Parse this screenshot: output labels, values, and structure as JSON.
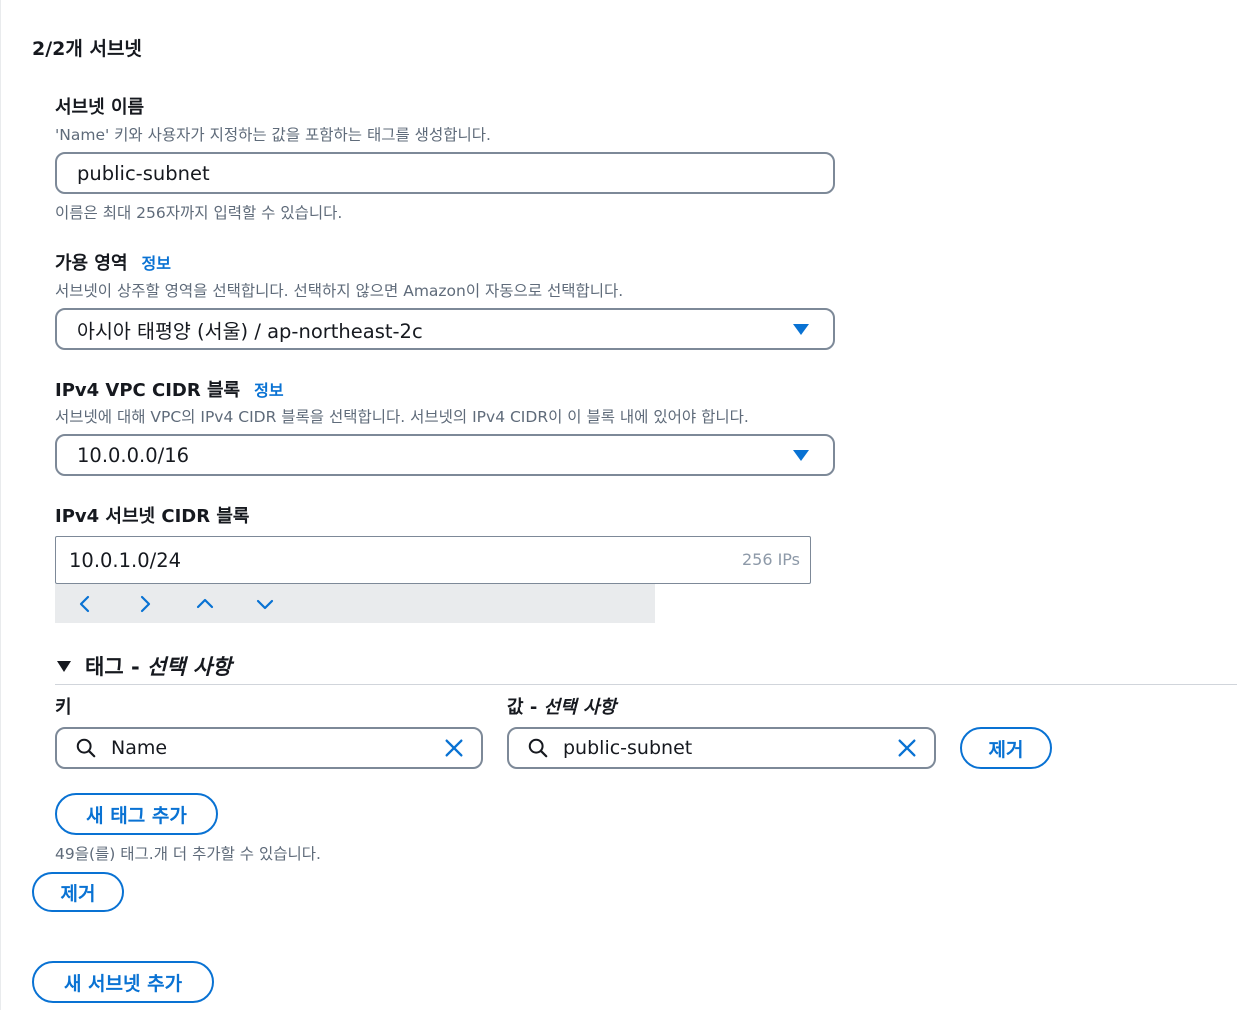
{
  "section": {
    "title": "2/2개 서브넷"
  },
  "subnet_name": {
    "label": "서브넷 이름",
    "description": "'Name' 키와 사용자가 지정하는 값을 포함하는 태그를 생성합니다.",
    "value": "public-subnet",
    "constraint": "이름은 최대 256자까지 입력할 수 있습니다."
  },
  "availability_zone": {
    "label": "가용 영역",
    "info": "정보",
    "description": "서브넷이 상주할 영역을 선택합니다. 선택하지 않으면 Amazon이 자동으로 선택합니다.",
    "value": "아시아 태평양 (서울) / ap-northeast-2c"
  },
  "vpc_cidr": {
    "label": "IPv4 VPC CIDR 블록",
    "info": "정보",
    "description": "서브넷에 대해 VPC의 IPv4 CIDR 블록을 선택합니다. 서브넷의 IPv4 CIDR이 이 블록 내에 있어야 합니다.",
    "value": "10.0.0.0/16"
  },
  "subnet_cidr": {
    "label": "IPv4 서브넷 CIDR 블록",
    "value": "10.0.1.0/24",
    "suffix": "256 IPs"
  },
  "tags": {
    "header_main": "태그 - ",
    "header_optional": "선택 사항",
    "key_label": "키",
    "value_label_main": "값 - ",
    "value_label_optional": "선택 사항",
    "rows": [
      {
        "key": "Name",
        "value": "public-subnet",
        "remove_label": "제거"
      }
    ],
    "add_label": "새 태그 추가",
    "remaining_hint": "49을(를) 태그.개 더 추가할 수 있습니다."
  },
  "remove_subnet_label": "제거",
  "add_subnet_label": "새 서브넷 추가",
  "colors": {
    "accent": "#0972d3",
    "border": "#7d8998",
    "muted": "#5f6b7a"
  }
}
